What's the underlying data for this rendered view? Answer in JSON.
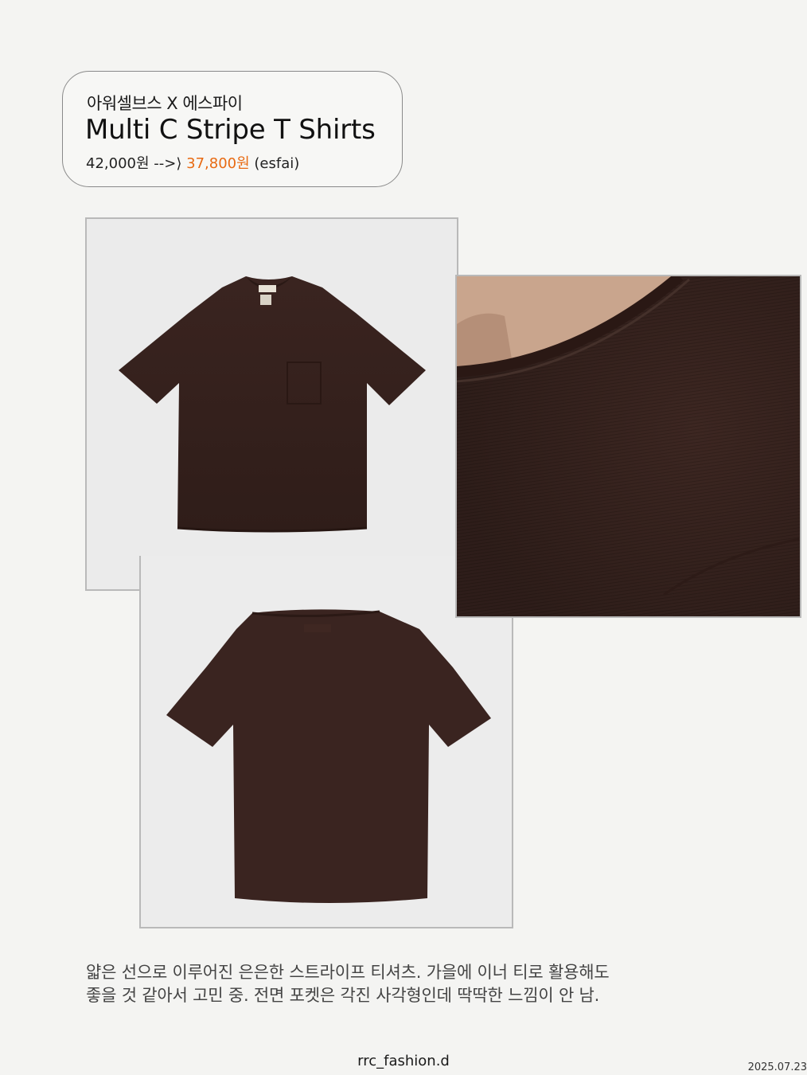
{
  "header": {
    "brand": "아워셀브스 X 에스파이",
    "product_name": "Multi C Stripe T Shirts",
    "original_price": "42,000원",
    "arrow": "-->",
    "sale_price": "37,800원",
    "shop": "(esfai)"
  },
  "colors": {
    "sale_price": "#e86a12",
    "shirt": "#3b2620"
  },
  "images": {
    "front": "brown-tshirt-front-photo",
    "detail": "brown-tshirt-collar-closeup-photo",
    "back": "brown-tshirt-back-photo"
  },
  "description": {
    "line1": "얇은 선으로 이루어진 은은한 스트라이프 티셔츠. 가을에 이너 티로 활용해도",
    "line2": "좋을 것 같아서 고민 중. 전면 포켓은 각진 사각형인데 딱딱한 느낌이 안 남."
  },
  "footer": {
    "handle": "rrc_fashion.d",
    "date": "2025.07.23"
  }
}
